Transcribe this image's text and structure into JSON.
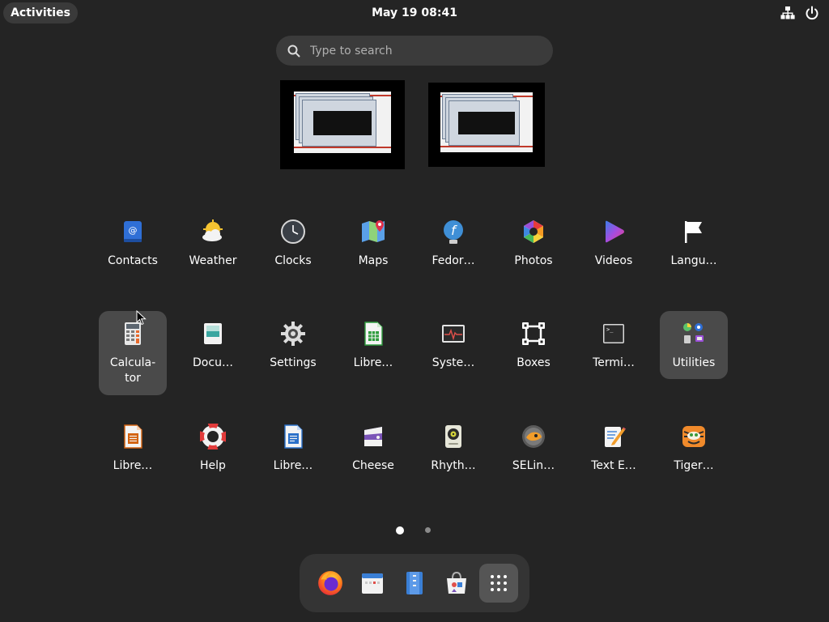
{
  "topbar": {
    "activities": "Activities",
    "datetime": "May 19  08:41",
    "tray_icons": [
      "network-icon",
      "power-icon"
    ]
  },
  "search": {
    "placeholder": "Type to search"
  },
  "workspaces": {
    "count": 2
  },
  "apps": [
    {
      "label": "Contacts",
      "icon": "contacts-icon"
    },
    {
      "label": "Weather",
      "icon": "weather-icon"
    },
    {
      "label": "Clocks",
      "icon": "clocks-icon"
    },
    {
      "label": "Maps",
      "icon": "maps-icon"
    },
    {
      "label": "Fedor…",
      "icon": "fedora-icon"
    },
    {
      "label": "Photos",
      "icon": "photos-icon"
    },
    {
      "label": "Videos",
      "icon": "videos-icon"
    },
    {
      "label": "Langu…",
      "icon": "language-flag-icon"
    },
    {
      "label": "Calcula-\ntor",
      "icon": "calculator-icon"
    },
    {
      "label": "Docu…",
      "icon": "document-viewer-icon"
    },
    {
      "label": "Settings",
      "icon": "settings-gear-icon"
    },
    {
      "label": "Libre…",
      "icon": "libreoffice-calc-icon"
    },
    {
      "label": "Syste…",
      "icon": "system-monitor-icon"
    },
    {
      "label": "Boxes",
      "icon": "boxes-icon"
    },
    {
      "label": "Termi…",
      "icon": "terminal-icon"
    },
    {
      "label": "Utilities",
      "icon": "utilities-folder-icon"
    },
    {
      "label": "Libre…",
      "icon": "libreoffice-impress-icon"
    },
    {
      "label": "Help",
      "icon": "help-lifebuoy-icon"
    },
    {
      "label": "Libre…",
      "icon": "libreoffice-writer-icon"
    },
    {
      "label": "Cheese",
      "icon": "cheese-icon"
    },
    {
      "label": "Rhyth…",
      "icon": "rhythmbox-icon"
    },
    {
      "label": "SELin…",
      "icon": "selinux-icon"
    },
    {
      "label": "Text E…",
      "icon": "text-editor-icon"
    },
    {
      "label": "Tiger…",
      "icon": "tigervnc-icon"
    }
  ],
  "pages": {
    "current": 1,
    "total": 2
  },
  "dash": [
    {
      "name": "firefox-icon"
    },
    {
      "name": "calendar-icon"
    },
    {
      "name": "files-icon"
    },
    {
      "name": "software-icon"
    },
    {
      "name": "show-apps-grid-icon"
    }
  ]
}
